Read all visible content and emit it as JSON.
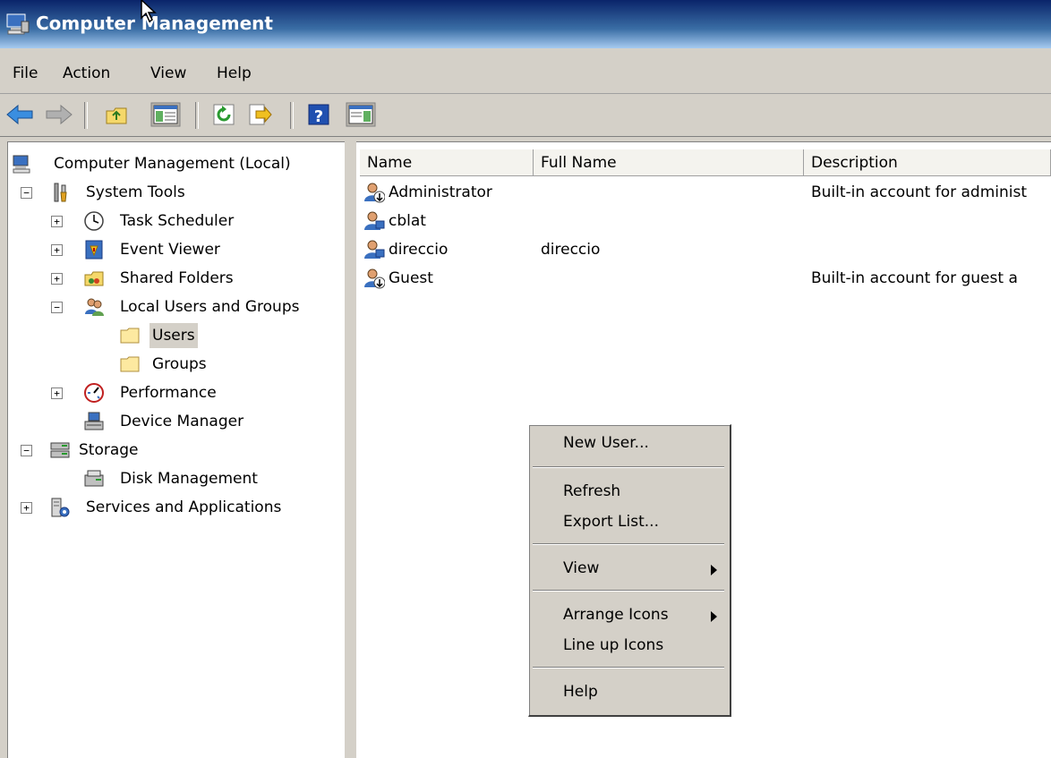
{
  "window": {
    "title": "Computer Management"
  },
  "menu": [
    "File",
    "Action",
    "View",
    "Help"
  ],
  "tree": {
    "root": "Computer Management (Local)",
    "system_tools": "System Tools",
    "task_scheduler": "Task Scheduler",
    "event_viewer": "Event Viewer",
    "shared_folders": "Shared Folders",
    "local_users_groups": "Local Users and Groups",
    "users": "Users",
    "groups": "Groups",
    "performance": "Performance",
    "device_manager": "Device Manager",
    "storage": "Storage",
    "disk_management": "Disk Management",
    "services_apps": "Services and Applications"
  },
  "list": {
    "columns": [
      "Name",
      "Full Name",
      "Description"
    ],
    "rows": [
      {
        "name": "Administrator",
        "full_name": "",
        "description": "Built-in account for administ"
      },
      {
        "name": "cblat",
        "full_name": "",
        "description": ""
      },
      {
        "name": "direccio",
        "full_name": "direccio",
        "description": ""
      },
      {
        "name": "Guest",
        "full_name": "",
        "description": "Built-in account for guest a"
      }
    ]
  },
  "context_menu": {
    "new_user": "New User...",
    "refresh": "Refresh",
    "export_list": "Export List...",
    "view": "View",
    "arrange_icons": "Arrange Icons",
    "line_up_icons": "Line up Icons",
    "help": "Help"
  },
  "icons": {
    "app": "computer-management-icon",
    "back": "back-arrow-icon",
    "forward": "forward-arrow-icon",
    "up": "up-folder-icon",
    "show_hide_tree": "show-hide-tree-icon",
    "refresh": "refresh-icon",
    "export": "export-list-icon",
    "help": "help-icon",
    "action_pane": "action-pane-icon"
  }
}
